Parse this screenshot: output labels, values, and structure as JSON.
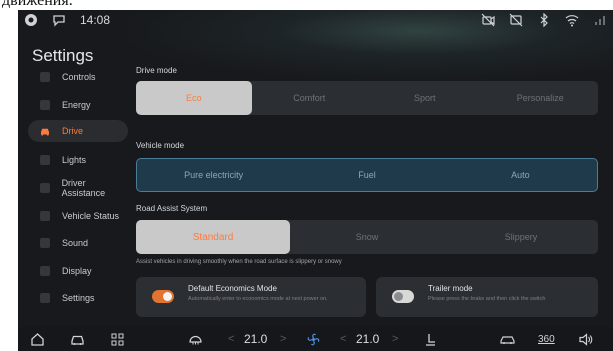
{
  "caption": "движения.",
  "status_bar": {
    "time": "14:08",
    "icons": [
      "camera-icon",
      "chat-icon",
      "camera-off-icon",
      "device-off-icon",
      "bluetooth-icon",
      "wifi-icon",
      "signal-icon"
    ]
  },
  "sidebar": {
    "title": "Settings",
    "items": [
      {
        "label": "Controls"
      },
      {
        "label": "Energy"
      },
      {
        "label": "Drive",
        "active": true
      },
      {
        "label": "Lights"
      },
      {
        "label": "Driver Assistance"
      },
      {
        "label": "Vehicle Status"
      },
      {
        "label": "Sound"
      },
      {
        "label": "Display"
      },
      {
        "label": "Settings"
      }
    ]
  },
  "drive_mode": {
    "label": "Drive mode",
    "options": [
      "Eco",
      "Comfort",
      "Sport",
      "Personalize"
    ],
    "selected": "Eco"
  },
  "vehicle_mode": {
    "label": "Vehicle mode",
    "options": [
      "Pure electricity",
      "Fuel",
      "Auto"
    ]
  },
  "road_assist": {
    "label": "Road Assist System",
    "options": [
      "Standard",
      "Snow",
      "Slippery"
    ],
    "selected": "Standard",
    "hint": "Assist vehicles in driving smoothly when the road surface is slippery or snowy"
  },
  "default_economics": {
    "title": "Default Economics Mode",
    "desc": "Automatically enter to economics mode at next power on.",
    "enabled": true
  },
  "trailer_mode": {
    "title": "Trailer mode",
    "desc": "Please press the brake and then click the switch",
    "enabled": false
  },
  "bottom_bar": {
    "left_temp": "21.0",
    "right_temp": "21.0",
    "chev_left": "<",
    "chev_right": ">",
    "cam_360": "360",
    "icons": [
      "home-icon",
      "car-icon",
      "apps-grid-icon",
      "defrost-icon",
      "fan-icon",
      "seat-heat-icon",
      "car-view-icon",
      "camera-360-icon",
      "volume-icon"
    ]
  },
  "colors": {
    "accent": "#ff7a3d",
    "background": "#17191c",
    "panel": "#2b2e32",
    "vehicle_mode_bg": "#1f3a4b"
  }
}
